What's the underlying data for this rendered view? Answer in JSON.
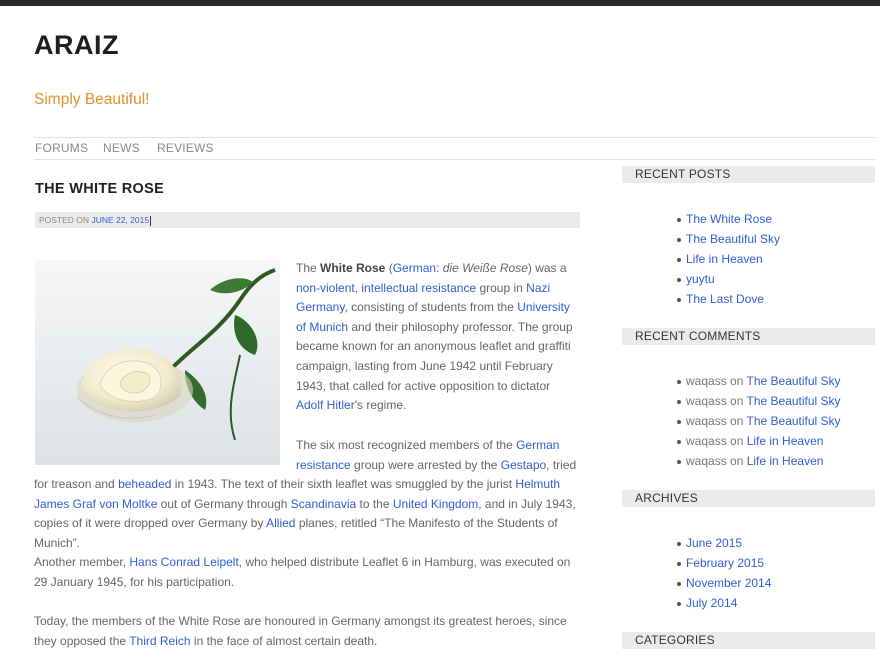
{
  "site": {
    "title": "ARAIZ",
    "tagline": "Simply Beautiful!"
  },
  "nav": {
    "forums": "FORUMS",
    "news": "NEWS",
    "reviews": "REVIEWS"
  },
  "post": {
    "title": "THE WHITE ROSE",
    "meta_prefix": "POSTED ON",
    "meta_date": "JUNE 22, 2015",
    "image_alt": "white rose",
    "p1": {
      "t1": "The ",
      "bold": "White Rose",
      "t2": " (",
      "l1": "German",
      "t3": ": ",
      "ital": "die Weiße Rose",
      "t4": ") was a",
      "l2": "non-violent",
      "t5": ", ",
      "l3": "intellectual resistance",
      "t6": " group in ",
      "l4": "Nazi Germany",
      "t7": ", consisting of students from the ",
      "l5": "University of Munich",
      "t8": " and their philosophy professor. The group became known for an anonymous leaflet and graffiti campaign, lasting from June 1942 until February 1943, that called for active opposition to dictator ",
      "l6": "Adolf Hitler",
      "t9": "'s regime."
    },
    "p2": {
      "t1": "The six most recognized members of the ",
      "l1": "German resistance",
      "t2": " group were arrested by the ",
      "l2": "Gestapo",
      "t3": ", tried",
      "t4": "for treason and ",
      "l3": "beheaded",
      "t5": " in 1943. The text of their sixth leaflet was smuggled by the jurist ",
      "l4": "Helmuth James Graf von Moltke",
      "t6": " out of Germany through ",
      "l5": "Scandinavia",
      "t7": " to the ",
      "l6": "United Kingdom",
      "t8": ", and in July 1943, copies of it were dropped over Germany by ",
      "l7": "Allied",
      "t9": " planes, retitled “The Manifesto of the Students of Munich”."
    },
    "p3": {
      "t1": "Another member, ",
      "l1": "Hans Conrad Leipelt",
      "t2": ", who helped distribute Leaflet 6 in Hamburg, was executed on 29 January 1945, for his participation."
    },
    "p4": {
      "t1": "Today, the members of the White Rose are honoured in Germany amongst its greatest heroes, since they opposed the ",
      "l1": "Third Reich",
      "t2": " in the face of almost certain death."
    }
  },
  "sidebar": {
    "recent_posts_title": "RECENT POSTS",
    "recent_posts": [
      "The White Rose",
      "The Beautiful Sky",
      "Life in Heaven",
      "yuytu",
      "The Last Dove"
    ],
    "recent_comments_title": "RECENT COMMENTS",
    "recent_comments": [
      {
        "author": "waqass",
        "on": " on ",
        "post": "The Beautiful Sky"
      },
      {
        "author": "waqass",
        "on": " on ",
        "post": "The Beautiful Sky"
      },
      {
        "author": "waqass",
        "on": " on ",
        "post": "The Beautiful Sky"
      },
      {
        "author": "waqass",
        "on": " on ",
        "post": "Life in Heaven"
      },
      {
        "author": "waqass",
        "on": " on ",
        "post": "Life in Heaven"
      }
    ],
    "archives_title": "ARCHIVES",
    "archives": [
      "June 2015",
      "February 2015",
      "November 2014",
      "July 2014"
    ],
    "categories_title": "CATEGORIES"
  },
  "colors": {
    "link": "#2f5fd0",
    "tagline": "#e0902d",
    "topbar": "#2a2a2a",
    "widget_bg": "#ebebeb"
  }
}
